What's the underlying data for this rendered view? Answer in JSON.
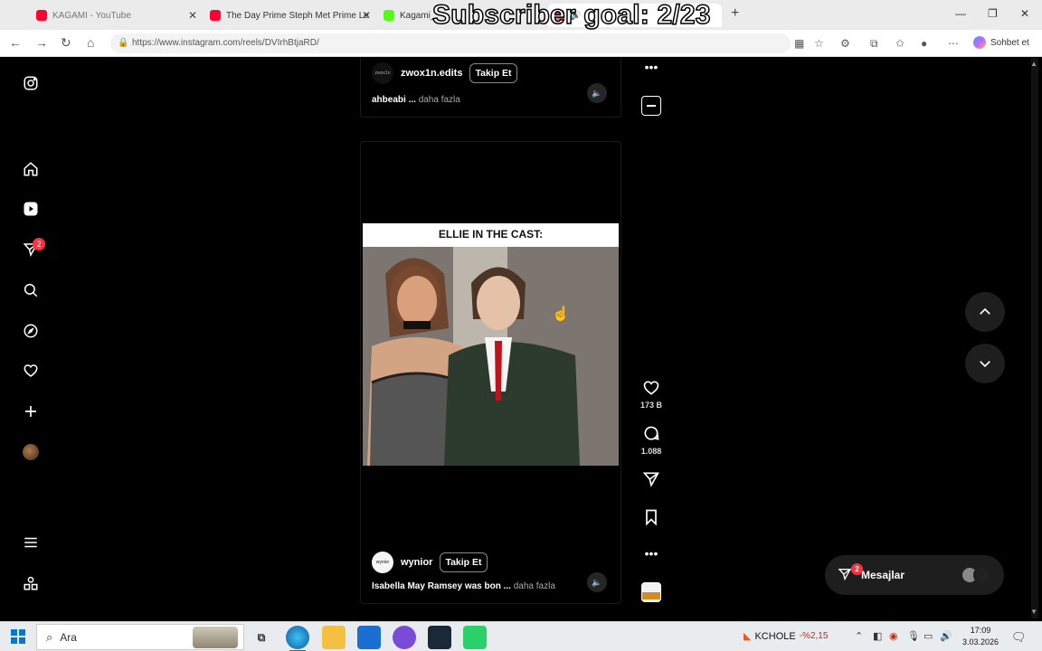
{
  "overlay": {
    "text": "Subscriber goal: 2/23"
  },
  "browser": {
    "tabs": [
      {
        "title": "KAGAMI - YouTube",
        "icon": "youtube-icon"
      },
      {
        "title": "The Day Prime Steph Met Prime Le",
        "icon": "youtube-icon"
      },
      {
        "title": "Kagami_",
        "icon": "kick-icon"
      },
      {
        "title": "",
        "icon": "instagram-icon"
      }
    ],
    "new_tab": "+",
    "url": "https://www.instagram.com/reels/DVIrhBtjaRD/",
    "copilot_label": "Sohbet et"
  },
  "reels": {
    "top": {
      "username": "zwox1n.edits",
      "avatar_text": "zwox1n",
      "follow": "Takip Et",
      "caption": "ahbeabi ...",
      "more": "daha fazla"
    },
    "main": {
      "video_title": "ELLIE IN THE CAST:",
      "username": "wynior",
      "avatar_text": "wynior",
      "follow": "Takip Et",
      "caption": "Isabella May Ramsey was bon ...",
      "more": "daha fazla",
      "likes": "173 B",
      "comments": "1.088"
    }
  },
  "sidebar": {
    "notifications_badge": "2"
  },
  "messages": {
    "label": "Mesajlar",
    "badge": "2"
  },
  "taskbar": {
    "search_placeholder": "Ara",
    "stock_name": "KCHOLE",
    "stock_change": "-%2,15",
    "time": "17:09",
    "date": "3.03.2026"
  },
  "colors": {
    "instagram_bg": "#000000",
    "badge_red": "#ff3040",
    "taskbar_accent": "#0078d4"
  }
}
